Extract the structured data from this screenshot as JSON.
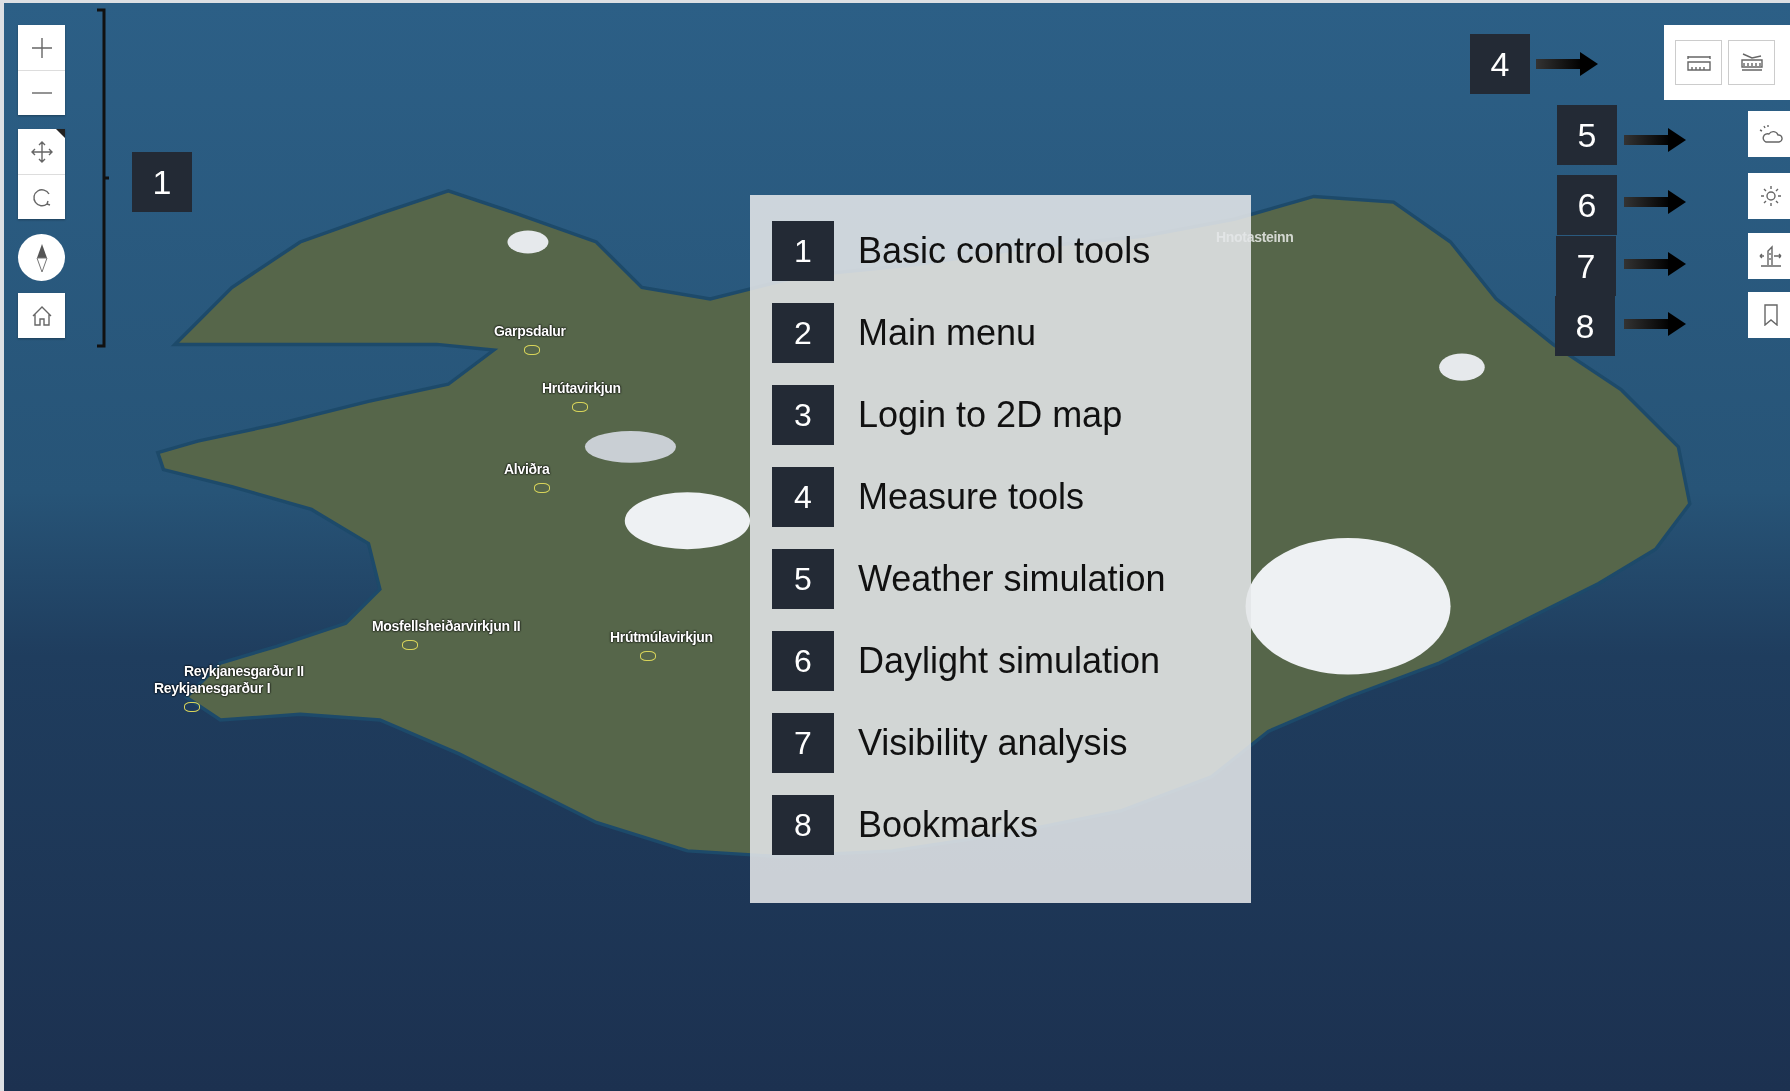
{
  "map_labels": [
    "Garpsdalur",
    "Hrútavirkjun",
    "Alviðra",
    "Mosfellsheiðarvirkjun II",
    "Hrútmúlavirkjun",
    "Reykjanesgarður II",
    "Reykjanesgarður I",
    "Hnotasteinn"
  ],
  "callouts": [
    "1",
    "4",
    "5",
    "6",
    "7",
    "8"
  ],
  "legend": {
    "items": [
      {
        "number": "1",
        "label": "Basic control tools"
      },
      {
        "number": "2",
        "label": "Main menu"
      },
      {
        "number": "3",
        "label": "Login to 2D map"
      },
      {
        "number": "4",
        "label": "Measure tools"
      },
      {
        "number": "5",
        "label": "Weather simulation"
      },
      {
        "number": "6",
        "label": "Daylight simulation"
      },
      {
        "number": "7",
        "label": "Visibility analysis"
      },
      {
        "number": "8",
        "label": "Bookmarks"
      }
    ]
  }
}
